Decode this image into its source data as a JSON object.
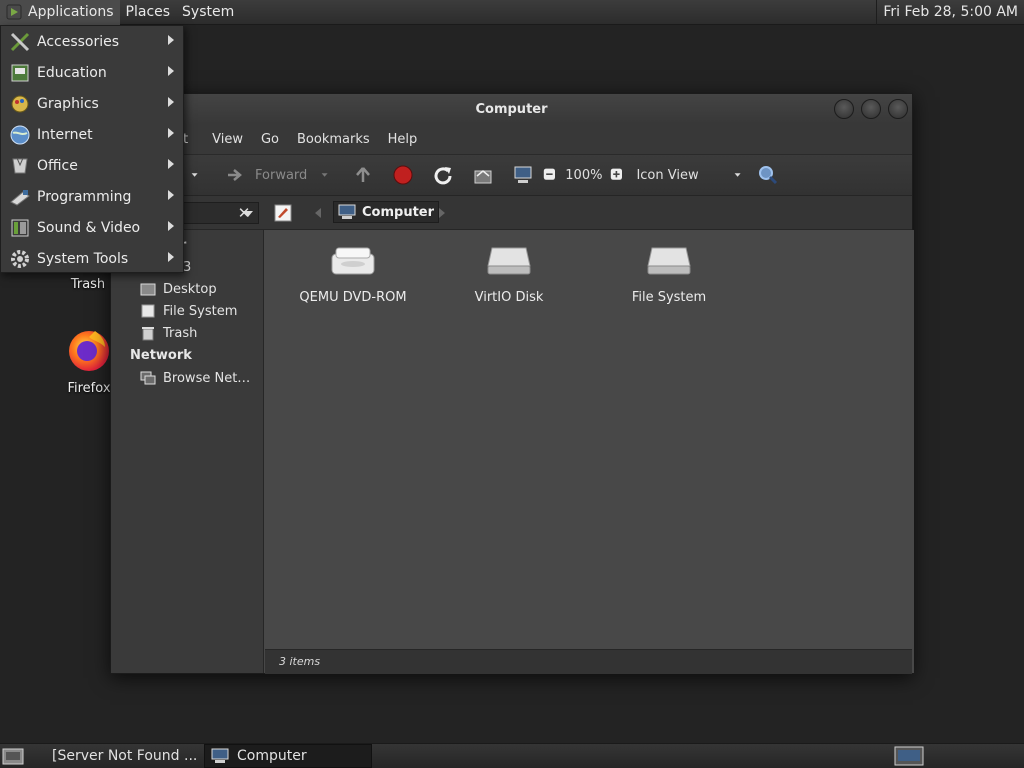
{
  "top_panel": {
    "menus": [
      "Applications",
      "Places",
      "System"
    ],
    "clock": "Fri Feb 28,  5:00 AM"
  },
  "app_menu": {
    "items": [
      {
        "label": "Accessories",
        "icon": "accessories-icon"
      },
      {
        "label": "Education",
        "icon": "education-icon"
      },
      {
        "label": "Graphics",
        "icon": "graphics-icon"
      },
      {
        "label": "Internet",
        "icon": "internet-icon"
      },
      {
        "label": "Office",
        "icon": "office-icon"
      },
      {
        "label": "Programming",
        "icon": "programming-icon"
      },
      {
        "label": "Sound & Video",
        "icon": "sound-video-icon"
      },
      {
        "label": "System Tools",
        "icon": "system-tools-icon"
      }
    ]
  },
  "desktop": {
    "icons": [
      {
        "label": "Trash",
        "icon": "trash-icon"
      },
      {
        "label": "Firefox",
        "icon": "firefox-icon"
      }
    ]
  },
  "window": {
    "title": "Computer",
    "menubar": [
      "t",
      "View",
      "Go",
      "Bookmarks",
      "Help"
    ],
    "toolbar": {
      "forward": "Forward",
      "zoom": "100%",
      "view_mode": "Icon View"
    },
    "location": {
      "crumb": "Computer"
    },
    "sidebar": {
      "head_partial": "er",
      "partial_item": "3",
      "items": [
        "Desktop",
        "File System",
        "Trash"
      ],
      "network_head": "Network",
      "network_items": [
        "Browse Net…"
      ]
    },
    "files": [
      {
        "label": "QEMU DVD-ROM",
        "icon": "optical-drive-icon"
      },
      {
        "label": "VirtIO Disk",
        "icon": "hard-disk-icon"
      },
      {
        "label": "File System",
        "icon": "hard-disk-icon"
      }
    ],
    "status": "3 items"
  },
  "bottom_panel": {
    "tasks": [
      "[Server Not Found ...",
      "Computer"
    ]
  },
  "colors": {
    "panel": "#2c2c2c",
    "window_bg": "#383838",
    "content_bg": "#484848",
    "stop_red": "#c0201f"
  }
}
